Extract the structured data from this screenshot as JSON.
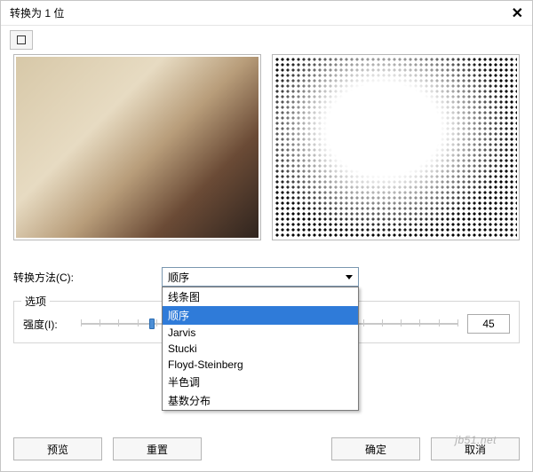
{
  "title": "转换为 1 位",
  "combo": {
    "label_method": "转换方法(C):",
    "selected": "顺序",
    "options": [
      "线条图",
      "顺序",
      "Jarvis",
      "Stucki",
      "Floyd-Steinberg",
      "半色调",
      "基数分布"
    ]
  },
  "options_legend": "选项",
  "intensity": {
    "label": "强度(I):",
    "value": "45"
  },
  "buttons": {
    "preview": "预览",
    "reset": "重置",
    "ok": "确定",
    "cancel": "取消"
  },
  "watermark": "jb51.net"
}
